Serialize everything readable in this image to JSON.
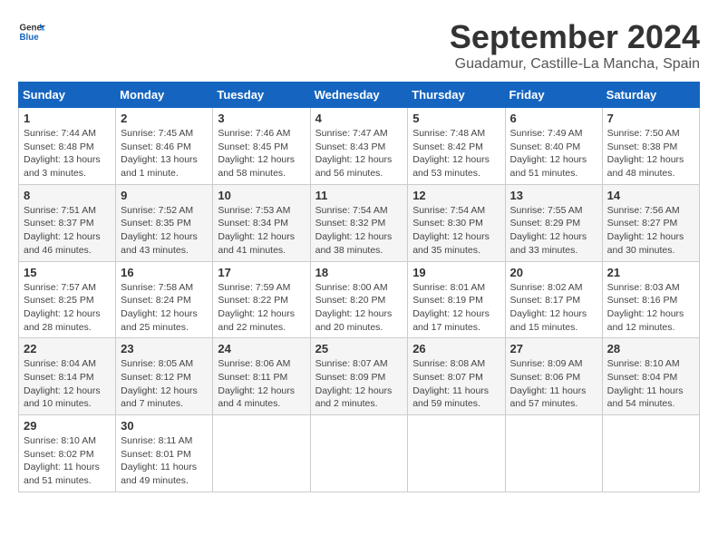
{
  "logo": {
    "general": "General",
    "blue": "Blue"
  },
  "title": "September 2024",
  "location": "Guadamur, Castille-La Mancha, Spain",
  "days_of_week": [
    "Sunday",
    "Monday",
    "Tuesday",
    "Wednesday",
    "Thursday",
    "Friday",
    "Saturday"
  ],
  "weeks": [
    [
      {
        "day": "1",
        "sunrise": "7:44 AM",
        "sunset": "8:48 PM",
        "daylight": "13 hours and 3 minutes."
      },
      {
        "day": "2",
        "sunrise": "7:45 AM",
        "sunset": "8:46 PM",
        "daylight": "13 hours and 1 minute."
      },
      {
        "day": "3",
        "sunrise": "7:46 AM",
        "sunset": "8:45 PM",
        "daylight": "12 hours and 58 minutes."
      },
      {
        "day": "4",
        "sunrise": "7:47 AM",
        "sunset": "8:43 PM",
        "daylight": "12 hours and 56 minutes."
      },
      {
        "day": "5",
        "sunrise": "7:48 AM",
        "sunset": "8:42 PM",
        "daylight": "12 hours and 53 minutes."
      },
      {
        "day": "6",
        "sunrise": "7:49 AM",
        "sunset": "8:40 PM",
        "daylight": "12 hours and 51 minutes."
      },
      {
        "day": "7",
        "sunrise": "7:50 AM",
        "sunset": "8:38 PM",
        "daylight": "12 hours and 48 minutes."
      }
    ],
    [
      {
        "day": "8",
        "sunrise": "7:51 AM",
        "sunset": "8:37 PM",
        "daylight": "12 hours and 46 minutes."
      },
      {
        "day": "9",
        "sunrise": "7:52 AM",
        "sunset": "8:35 PM",
        "daylight": "12 hours and 43 minutes."
      },
      {
        "day": "10",
        "sunrise": "7:53 AM",
        "sunset": "8:34 PM",
        "daylight": "12 hours and 41 minutes."
      },
      {
        "day": "11",
        "sunrise": "7:54 AM",
        "sunset": "8:32 PM",
        "daylight": "12 hours and 38 minutes."
      },
      {
        "day": "12",
        "sunrise": "7:54 AM",
        "sunset": "8:30 PM",
        "daylight": "12 hours and 35 minutes."
      },
      {
        "day": "13",
        "sunrise": "7:55 AM",
        "sunset": "8:29 PM",
        "daylight": "12 hours and 33 minutes."
      },
      {
        "day": "14",
        "sunrise": "7:56 AM",
        "sunset": "8:27 PM",
        "daylight": "12 hours and 30 minutes."
      }
    ],
    [
      {
        "day": "15",
        "sunrise": "7:57 AM",
        "sunset": "8:25 PM",
        "daylight": "12 hours and 28 minutes."
      },
      {
        "day": "16",
        "sunrise": "7:58 AM",
        "sunset": "8:24 PM",
        "daylight": "12 hours and 25 minutes."
      },
      {
        "day": "17",
        "sunrise": "7:59 AM",
        "sunset": "8:22 PM",
        "daylight": "12 hours and 22 minutes."
      },
      {
        "day": "18",
        "sunrise": "8:00 AM",
        "sunset": "8:20 PM",
        "daylight": "12 hours and 20 minutes."
      },
      {
        "day": "19",
        "sunrise": "8:01 AM",
        "sunset": "8:19 PM",
        "daylight": "12 hours and 17 minutes."
      },
      {
        "day": "20",
        "sunrise": "8:02 AM",
        "sunset": "8:17 PM",
        "daylight": "12 hours and 15 minutes."
      },
      {
        "day": "21",
        "sunrise": "8:03 AM",
        "sunset": "8:16 PM",
        "daylight": "12 hours and 12 minutes."
      }
    ],
    [
      {
        "day": "22",
        "sunrise": "8:04 AM",
        "sunset": "8:14 PM",
        "daylight": "12 hours and 10 minutes."
      },
      {
        "day": "23",
        "sunrise": "8:05 AM",
        "sunset": "8:12 PM",
        "daylight": "12 hours and 7 minutes."
      },
      {
        "day": "24",
        "sunrise": "8:06 AM",
        "sunset": "8:11 PM",
        "daylight": "12 hours and 4 minutes."
      },
      {
        "day": "25",
        "sunrise": "8:07 AM",
        "sunset": "8:09 PM",
        "daylight": "12 hours and 2 minutes."
      },
      {
        "day": "26",
        "sunrise": "8:08 AM",
        "sunset": "8:07 PM",
        "daylight": "11 hours and 59 minutes."
      },
      {
        "day": "27",
        "sunrise": "8:09 AM",
        "sunset": "8:06 PM",
        "daylight": "11 hours and 57 minutes."
      },
      {
        "day": "28",
        "sunrise": "8:10 AM",
        "sunset": "8:04 PM",
        "daylight": "11 hours and 54 minutes."
      }
    ],
    [
      {
        "day": "29",
        "sunrise": "8:10 AM",
        "sunset": "8:02 PM",
        "daylight": "11 hours and 51 minutes."
      },
      {
        "day": "30",
        "sunrise": "8:11 AM",
        "sunset": "8:01 PM",
        "daylight": "11 hours and 49 minutes."
      },
      null,
      null,
      null,
      null,
      null
    ]
  ],
  "labels": {
    "sunrise": "Sunrise:",
    "sunset": "Sunset:",
    "daylight": "Daylight:"
  }
}
